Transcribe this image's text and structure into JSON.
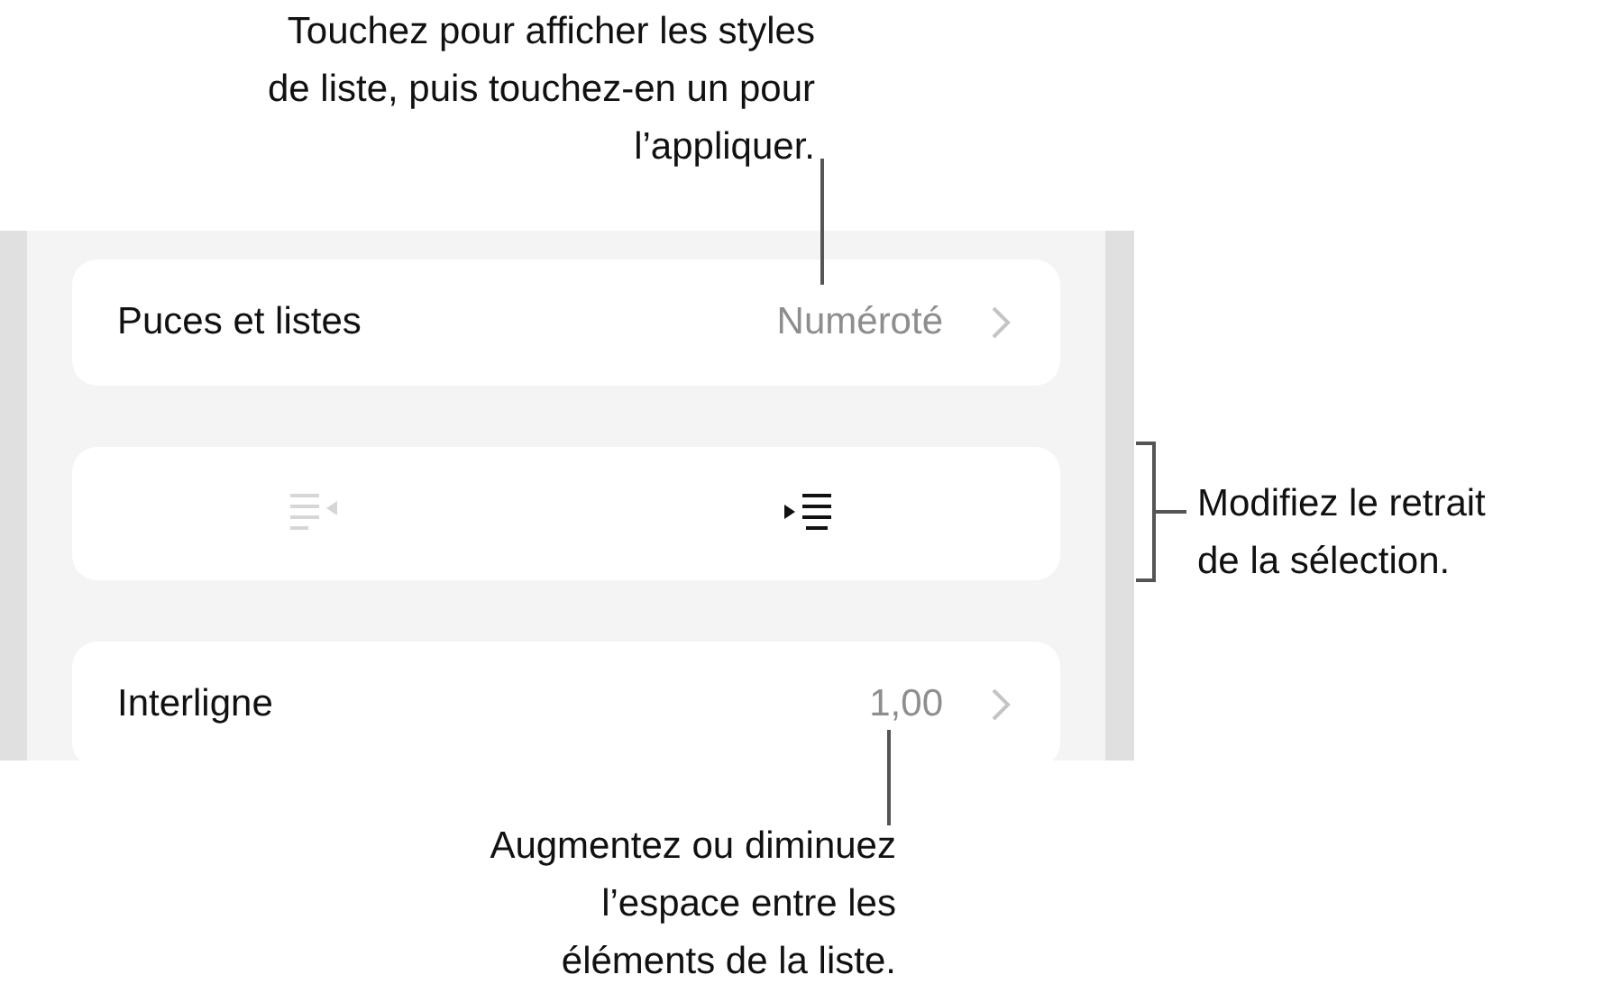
{
  "callouts": {
    "top": [
      "Touchez pour afficher les styles",
      "de liste, puis touchez-en un pour",
      "l’appliquer."
    ],
    "right": [
      "Modifiez le retrait",
      "de la sélection."
    ],
    "bottom": [
      "Augmentez ou diminuez",
      "l’espace entre les",
      "éléments de la liste."
    ]
  },
  "rows": [
    {
      "label": "Puces et listes",
      "value": "Numéroté"
    },
    {
      "label": "Interligne",
      "value": "1,00"
    }
  ],
  "indent_buttons": [
    {
      "kind": "outdent",
      "disabled": true
    },
    {
      "kind": "indent",
      "disabled": false
    }
  ]
}
